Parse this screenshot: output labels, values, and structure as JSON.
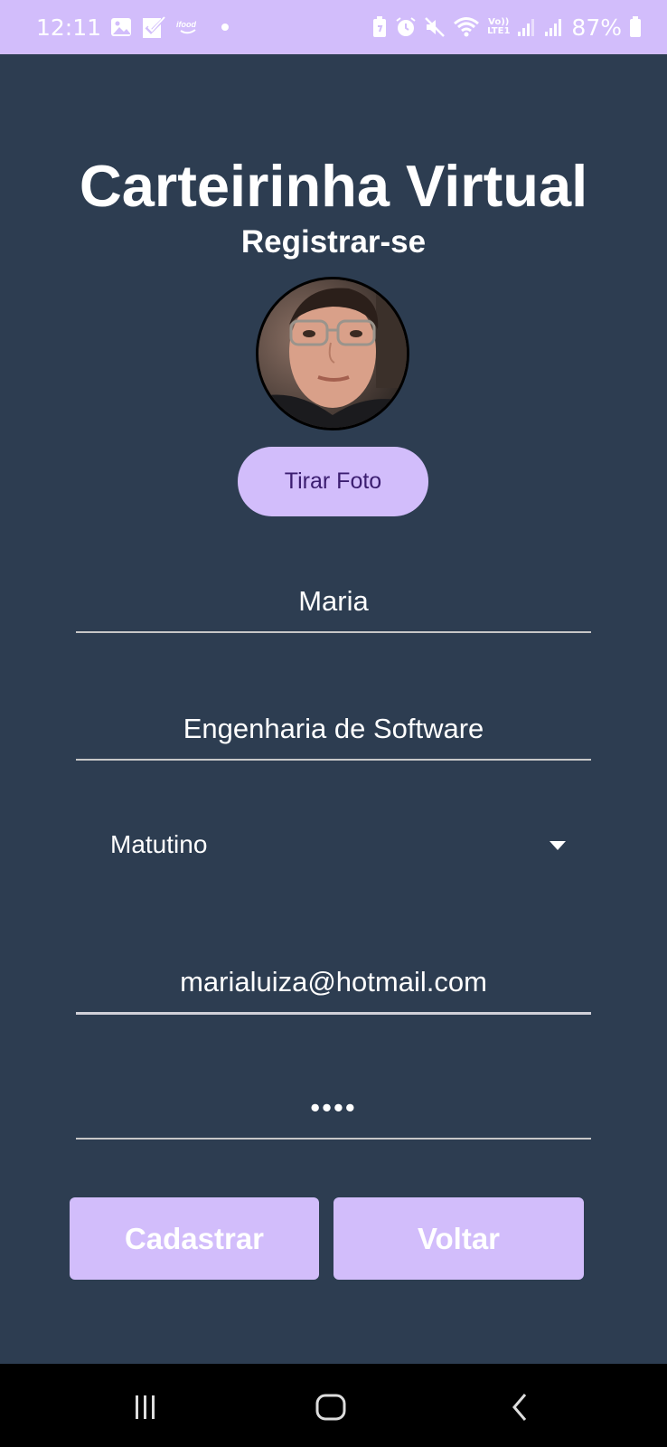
{
  "status_bar": {
    "time": "12:11",
    "battery_percent": "87%",
    "left_icons": [
      "gallery-icon",
      "check-app-icon",
      "ifood-icon",
      "dot-icon"
    ],
    "right_icons": [
      "battery-saver-icon",
      "alarm-icon",
      "mute-icon",
      "wifi-icon",
      "volte-icon",
      "signal-icon",
      "signal-icon",
      "battery-icon"
    ],
    "volte_label": "Vo))\nLTE1"
  },
  "header": {
    "title": "Carteirinha Virtual",
    "subtitle": "Registrar-se"
  },
  "profile": {
    "take_photo_label": "Tirar Foto"
  },
  "form": {
    "name_value": "Maria",
    "course_value": "Engenharia de Software",
    "shift_value": "Matutino",
    "email_value": "marialuiza@hotmail.com",
    "password_value": "••••"
  },
  "actions": {
    "register_label": "Cadastrar",
    "back_label": "Voltar"
  },
  "nav_bar": {
    "icons": [
      "recent-apps-icon",
      "home-icon",
      "back-icon"
    ]
  },
  "colors": {
    "background": "#2d3d51",
    "accent": "#d2bdfb",
    "photo_button_text": "#3b1d70"
  }
}
